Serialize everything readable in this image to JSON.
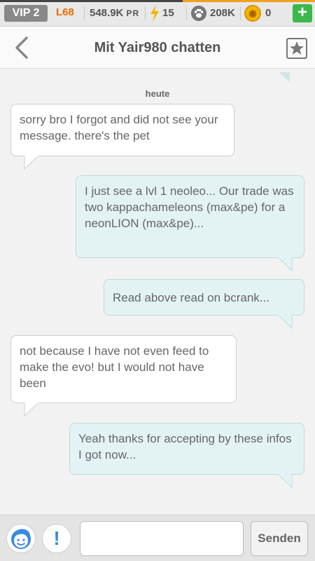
{
  "status_bar": {
    "vip": "VIP 2",
    "level": "L68",
    "pr_value": "548.9K",
    "pr_unit": "PR",
    "energy": "15",
    "food": "208K",
    "gold": "0",
    "add_label": "+"
  },
  "header": {
    "title": "Mit Yair980 chatten"
  },
  "chat": {
    "day_label": "heute",
    "messages": [
      {
        "side": "incoming",
        "text": "sorry bro I forgot and did not see your message. there's the pet"
      },
      {
        "side": "outgoing",
        "text": "I just see a lvl 1 neoleo... Our trade was two kappachameleons (max&pe) for a neonLION (max&pe)..."
      },
      {
        "side": "outgoing",
        "text": "Read above read on bcrank..."
      },
      {
        "side": "incoming",
        "text": "not because I have not even feed to make the evo! but I would not have been"
      },
      {
        "side": "outgoing",
        "text": "Yeah thanks for accepting by these infos I got now..."
      }
    ]
  },
  "composer": {
    "input_value": "",
    "input_placeholder": "",
    "alert_label": "!",
    "send_label": "Senden"
  },
  "colors": {
    "accent_orange": "#f06a00",
    "add_green": "#3cb84a",
    "outgoing_bubble": "#e3f3f3",
    "incoming_bubble": "#ffffff",
    "link_blue": "#3a8be0"
  },
  "icons": {
    "energy": "lightning-bolt-icon",
    "food": "paw-icon",
    "gold": "gold-coin-icon",
    "back": "chevron-left-icon",
    "favorite": "star-icon",
    "avatar": "player-avatar-icon"
  }
}
